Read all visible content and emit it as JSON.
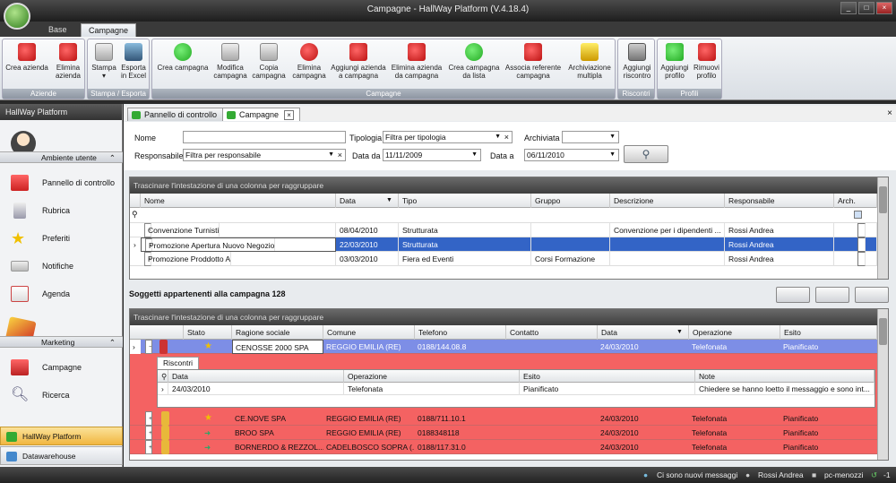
{
  "window": {
    "title": "Campagne - HallWay Platform (V.4.18.4)"
  },
  "ribbon_tabs": [
    "Base",
    "Campagne"
  ],
  "ribbon": {
    "groups": [
      {
        "title": "Aziende",
        "buttons": [
          "Crea azienda",
          "Elimina azienda"
        ]
      },
      {
        "title": "Stampa / Esporta",
        "buttons": [
          "Stampa",
          "Esporta in Excel"
        ]
      },
      {
        "title": "Campagne",
        "buttons": [
          "Crea campagna",
          "Modifica campagna",
          "Copia campagna",
          "Elimina campagna",
          "Aggiungi azienda a campagna",
          "Elimina azienda da campagna",
          "Crea campagna da lista",
          "Associa referente campagna",
          "Archiviazione multipla"
        ]
      },
      {
        "title": "Riscontri",
        "buttons": [
          "Aggiungi riscontro"
        ]
      },
      {
        "title": "Profili",
        "buttons": [
          "Aggiungi profilo",
          "Rimuovi profilo"
        ]
      }
    ]
  },
  "sidebar": {
    "header": "HallWay Platform",
    "section1": "Ambiente utente",
    "items1": [
      "Pannello di controllo",
      "Rubrica",
      "Preferiti",
      "Notifiche",
      "Agenda"
    ],
    "section2": "Marketing",
    "items2": [
      "Campagne",
      "Ricerca"
    ],
    "bottom_active": "HallWay Platform",
    "bottom_other": "Datawarehouse"
  },
  "doc_tabs": [
    "Pannello di controllo",
    "Campagne"
  ],
  "filters": {
    "nome_label": "Nome",
    "nome_value": "",
    "tipologia_label": "Tipologia",
    "tipologia_value": "Filtra per tipologia",
    "archiviata_label": "Archiviata",
    "archiviata_value": "",
    "responsabile_label": "Responsabile",
    "responsabile_value": "Filtra per responsabile",
    "data_da_label": "Data da",
    "data_da_value": "11/11/2009",
    "data_a_label": "Data a",
    "data_a_value": "06/11/2010"
  },
  "grid1": {
    "group_hint": "Trascinare l'intestazione di una colonna per raggruppare",
    "columns": [
      "Nome",
      "Data",
      "Tipo",
      "Gruppo",
      "Descrizione",
      "Responsabile",
      "Arch."
    ],
    "rows": [
      {
        "nome": "Convenzione Turnisti",
        "data": "08/04/2010",
        "tipo": "Strutturata",
        "gruppo": "",
        "descrizione": "Convenzione per i dipendenti ...",
        "responsabile": "Rossi Andrea"
      },
      {
        "nome": "Promozione Apertura Nuovo Negozio",
        "data": "22/03/2010",
        "tipo": "Strutturata",
        "gruppo": "",
        "descrizione": "",
        "responsabile": "Rossi Andrea"
      },
      {
        "nome": "Promozione Proddotto A",
        "data": "03/03/2010",
        "tipo": "Fiera ed Eventi",
        "gruppo": "Corsi Formazione",
        "descrizione": "",
        "responsabile": "Rossi Andrea"
      }
    ]
  },
  "subjects_title": "Soggetti appartenenti alla campagna 128",
  "grid2": {
    "group_hint": "Trascinare l'intestazione di una colonna per raggruppare",
    "columns": [
      "Stato",
      "Ragione sociale",
      "Comune",
      "Telefono",
      "Contatto",
      "Data",
      "Operazione",
      "Esito"
    ],
    "rows": [
      {
        "ragione": "CENOSSE 2000 SPA",
        "comune": "REGGIO EMILIA (RE)",
        "telefono": "0188/144.08.8",
        "contatto": "",
        "data": "24/03/2010",
        "operazione": "Telefonata",
        "esito": "Pianificato"
      },
      {
        "ragione": "CE.NOVE SPA",
        "comune": "REGGIO EMILIA (RE)",
        "telefono": "0188/711.10.1",
        "contatto": "",
        "data": "24/03/2010",
        "operazione": "Telefonata",
        "esito": "Pianificato"
      },
      {
        "ragione": "BROO SPA",
        "comune": "REGGIO EMILIA (RE)",
        "telefono": "0188348118",
        "contatto": "",
        "data": "24/03/2010",
        "operazione": "Telefonata",
        "esito": "Pianificato"
      },
      {
        "ragione": "BORNERDO & REZZOL...",
        "comune": "CADELBOSCO SOPRA (...",
        "telefono": "0188/117.31.0",
        "contatto": "",
        "data": "24/03/2010",
        "operazione": "Telefonata",
        "esito": "Pianificato"
      }
    ],
    "detail": {
      "tab": "Riscontri",
      "columns": [
        "Data",
        "Operazione",
        "Esito",
        "Note"
      ],
      "row": {
        "data": "24/03/2010",
        "operazione": "Telefonata",
        "esito": "Pianificato",
        "note": "Chiedere se hanno loetto il messaggio e sono int..."
      }
    }
  },
  "status": {
    "messages": "Ci sono nuovi messaggi",
    "user": "Rossi Andrea",
    "machine": "pc-menozzi",
    "counter": "-1"
  }
}
